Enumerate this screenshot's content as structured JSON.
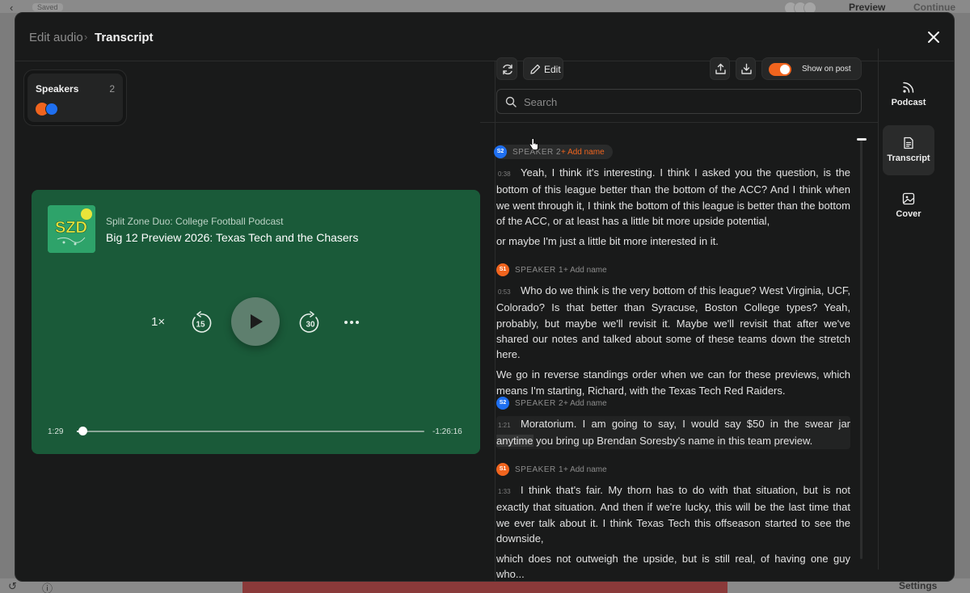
{
  "background": {
    "saved_badge": "Saved",
    "preview": "Preview",
    "continue": "Continue",
    "settings": "Settings"
  },
  "modal": {
    "breadcrumb_parent": "Edit audio",
    "breadcrumb_current": "Transcript"
  },
  "speakers": {
    "title": "Speakers",
    "count": "2"
  },
  "player": {
    "cover_text": "SZD",
    "podcast_name": "Split Zone Duo: College Football Podcast",
    "episode_title": "Big 12 Preview 2026: Texas Tech and the Chasers",
    "speed": "1×",
    "rewind_seconds": "15",
    "forward_seconds": "30",
    "time_current": "1:29",
    "time_remaining": "-1:26:16",
    "progress_fraction": 0.017
  },
  "toolbar": {
    "edit_label": "Edit",
    "show_on_post_label": "Show on post",
    "show_on_post_enabled": true
  },
  "search": {
    "placeholder": "Search"
  },
  "transcript": {
    "add_name_label": "+ Add name",
    "segments": [
      {
        "badge": "S2",
        "speaker": "SPEAKER 2",
        "paragraphs": [
          {
            "time": "0:38",
            "text": "Yeah, I think it's interesting. I think I asked you the question, is the bottom of this league better than the bottom of the ACC? And I think when we went through it, I think the bottom of this league is better than the bottom of the ACC, or at least has a little bit more upside potential,"
          },
          {
            "time": "",
            "text": "or maybe I'm just a little bit more interested in it."
          }
        ]
      },
      {
        "badge": "S1",
        "speaker": "SPEAKER 1",
        "paragraphs": [
          {
            "time": "0:53",
            "text": "Who do we think is the very bottom of this league? West Virginia, UCF, Colorado? Is that better than Syracuse, Boston College types? Yeah, probably, but maybe we'll revisit it. Maybe we'll revisit that after we've shared our notes and talked about some of these teams down the stretch here."
          },
          {
            "time": "",
            "text": "We go in reverse standings order when we can for these previews, which means I'm starting, Richard, with the Texas Tech Red Raiders."
          }
        ]
      },
      {
        "badge": "S2",
        "speaker": "SPEAKER 2",
        "paragraphs": [
          {
            "time": "1:21",
            "text_before": "Moratorium. I am going to say, I would say $50 in the swear jar ",
            "text_highlight": "anytime",
            "text_after": " you bring up Brendan Soresby's name in this team preview."
          }
        ]
      },
      {
        "badge": "S1",
        "speaker": "SPEAKER 1",
        "paragraphs": [
          {
            "time": "1:33",
            "text": "I think that's fair. My thorn has to do with that situation, but is not exactly that situation. And then if we're lucky, this will be the last time that we ever talk about it. I think Texas Tech this offseason started to see the downside,"
          },
          {
            "time": "",
            "text": "which does not outweigh the upside, but is still real, of having one guy who..."
          }
        ]
      }
    ]
  },
  "rail": {
    "podcast": "Podcast",
    "transcript": "Transcript",
    "cover": "Cover"
  },
  "colors": {
    "accent": "#f0641e",
    "speaker1": "#f0641e",
    "speaker2": "#1f6ff0",
    "player_bg": "#1a5a39",
    "modal_bg": "#191a1a"
  }
}
